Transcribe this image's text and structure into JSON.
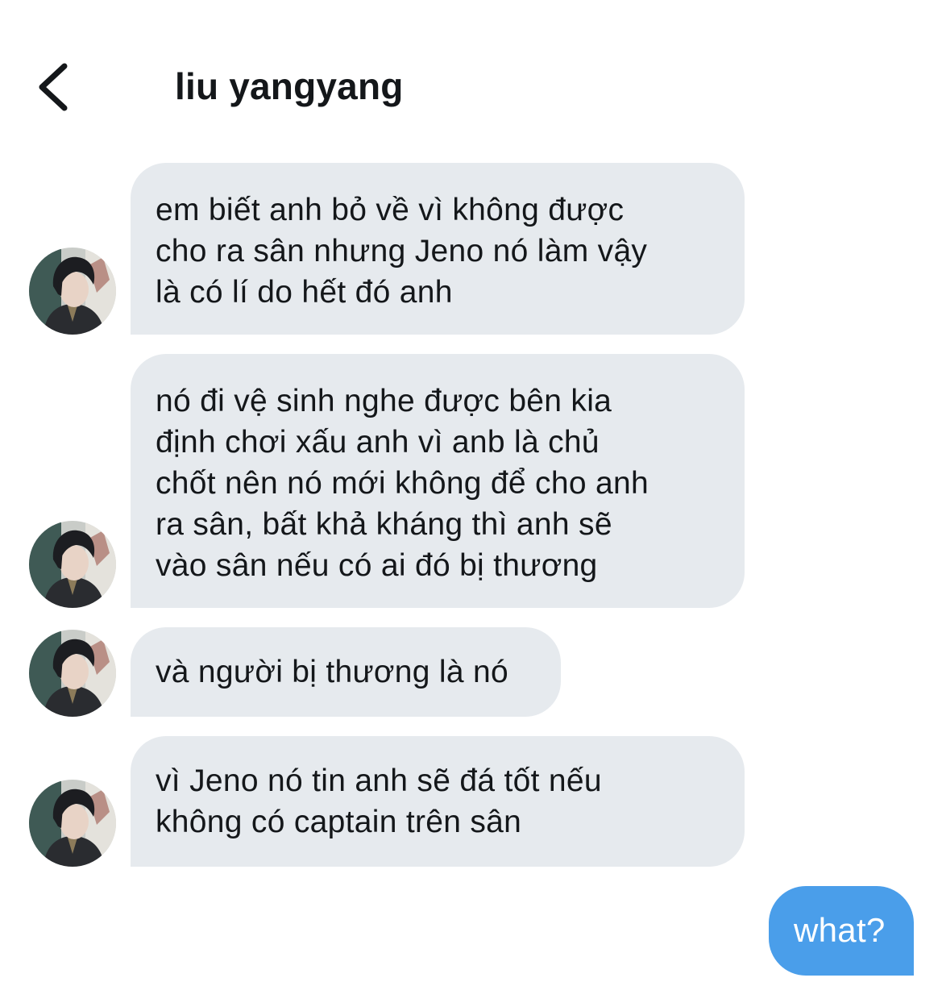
{
  "header": {
    "back_icon": "chevron-left-icon",
    "title": "liu yangyang"
  },
  "messages": [
    {
      "from": "liu yangyang",
      "lines": [
        "em biết anh bỏ về vì không được",
        "cho ra sân nhưng Jeno nó làm vậy",
        "là có lí do hết đó anh"
      ]
    },
    {
      "from": "liu yangyang",
      "lines": [
        "nó đi vệ sinh nghe được bên kia",
        "định chơi xấu anh vì anb là chủ",
        "chốt nên nó mới không để cho anh",
        "ra sân, bất khả kháng thì anh sẽ",
        "vào sân nếu có ai đó bị thương"
      ]
    },
    {
      "from": "liu yangyang",
      "lines": [
        "và người bị thương là nó"
      ]
    },
    {
      "from": "liu yangyang",
      "lines": [
        "vì Jeno nó tin anh sẽ đá tốt nếu",
        "không có captain trên sân"
      ]
    },
    {
      "from": "me",
      "lines": [
        "what?"
      ]
    }
  ],
  "colors": {
    "received_bubble": "#e6eaee",
    "sent_bubble": "#4a9eea",
    "text": "#14171a",
    "sent_text": "#ffffff"
  }
}
